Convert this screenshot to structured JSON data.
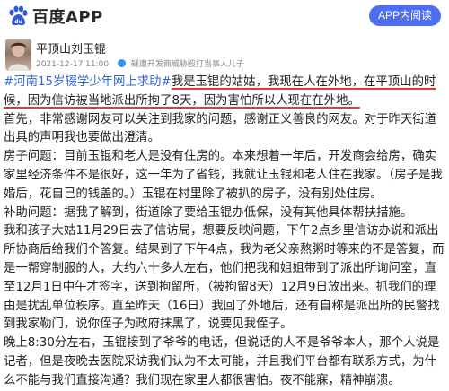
{
  "header": {
    "app_name": "百度APP",
    "open_app_label": "APP内阅读"
  },
  "author": {
    "name": "平顶山刘玉锟",
    "date": "2021-12-17 11:00",
    "verification": "疑遭开发商威胁殴打当事人儿子"
  },
  "article": {
    "hashtag": "#河南15岁辍学少年网上求助#",
    "p1_a": "我是玉锟的姑姑，我现在人在外地，",
    "p1_b": "在平顶山的时候，因为信访被当地派出所拘了8天，因为害怕所以人现在在外地。",
    "p2": "首先，非常感谢网友可以关注到我家的问题，感谢正义善良的网友。对于昨天街道出具的声明我也要做出澄清。",
    "p3": "房子问题：目前玉锟和老人是没有住房的。本来想着一年后，开发商会给房，确实家里经济条件不是很好，这一年为了省钱，我就让玉锟和老人住在我家。（房子是我婚后，花自己的钱盖的。）玉锟在村里除了被扒的房子，没有别处住房。",
    "p4": "补助问题：据我了解到，街道除了要给玉锟办低保，没有其他具体帮扶措施。",
    "p5": "我和孩子大姑11月29日去了信访局，想要反映问题，下午2点乡里信访办说和派出所协商后给我们个答复。结果到了下午4点，我为老父亲熬粥时等来的不是答复，而是一帮穿制服的人，大约六十多人左右，他们把我和姐姐带到了派出所询问室，直至12月1日中午才签字，送到拘留所，（被拘留8天）12月9日放出来。抓我们的理由是扰乱单位秩序。直至昨天（16日）我回了外地后，还有自称是派出所的民警找到我家勒门，说你侄子为政府抹黑了，说要见我侄子。",
    "p6": "晚上8:30分左右，玉锟接到了爷爷的电话，但说话的人不是爷爷本人，那个人说是记者，但是夜晚去医院采访我们认为不太可能，并且我们平台都有联系方式，为什么不能与我们直接沟通？我们现在家里人都很害怕。夜不能寐，精神崩溃。"
  },
  "colors": {
    "accent": "#4e6ef2",
    "hashtag": "#3366cc",
    "underline": "#e53935"
  }
}
